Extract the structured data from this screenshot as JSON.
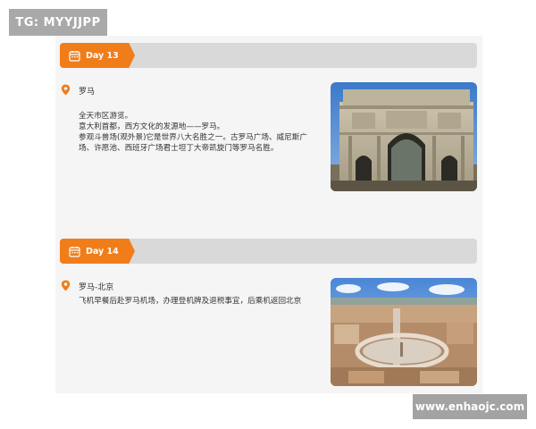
{
  "watermark": {
    "tg": "TG: MYYJJPP",
    "site": "www.enhaojc.com"
  },
  "days": [
    {
      "label": "Day 13",
      "place": "罗马",
      "lines": [
        "全天市区游览。",
        "意大利首都，西方文化的发源地——罗马。",
        "参观斗兽场(观外景)它是世界八大名胜之一。古罗马广场、威尼斯广",
        "场、许愿池、西班牙广场君士坦丁大帝凯旋门等罗马名胜。"
      ],
      "photo": "arch-of-constantine-photo"
    },
    {
      "label": "Day 14",
      "place": "罗马-北京",
      "lines": [
        "飞机早餐后赴罗马机场，办理登机牌及退税事宜，后乘机返回北京"
      ],
      "photo": "vatican-aerial-photo"
    }
  ],
  "colors": {
    "accent": "#f07d1a",
    "bar": "#d9d9d9",
    "panel": "#f5f5f5"
  },
  "icons": {
    "tab": "calendar-icon",
    "place": "location-pin-icon"
  }
}
